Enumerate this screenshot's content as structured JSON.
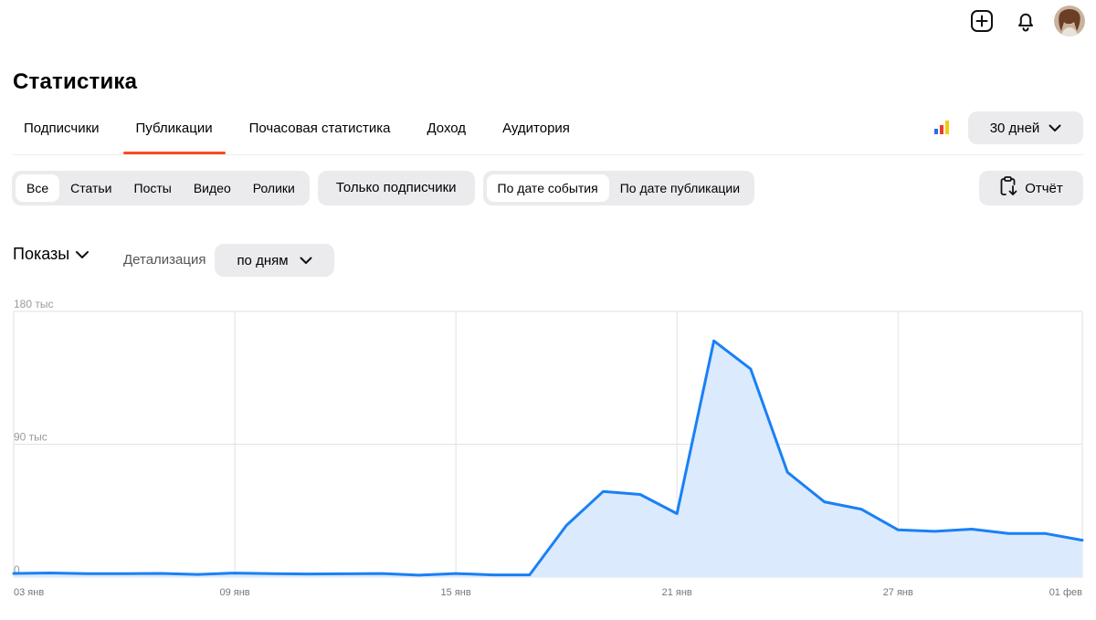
{
  "header": {
    "title": "Статистика",
    "icons": [
      "plus-square-icon",
      "bell-icon",
      "avatar"
    ]
  },
  "tabs": [
    {
      "label": "Подписчики",
      "active": false
    },
    {
      "label": "Публикации",
      "active": true
    },
    {
      "label": "Почасовая статистика",
      "active": false
    },
    {
      "label": "Доход",
      "active": false
    },
    {
      "label": "Аудитория",
      "active": false
    }
  ],
  "period": {
    "label": "30 дней"
  },
  "filters": {
    "types": [
      {
        "label": "Все",
        "active": true
      },
      {
        "label": "Статьи",
        "active": false
      },
      {
        "label": "Посты",
        "active": false
      },
      {
        "label": "Видео",
        "active": false
      },
      {
        "label": "Ролики",
        "active": false
      }
    ],
    "subscribers_only": "Только подписчики",
    "date_mode": [
      {
        "label": "По дате события",
        "active": true
      },
      {
        "label": "По дате публикации",
        "active": false
      }
    ],
    "report": "Отчёт"
  },
  "metric": {
    "label": "Показы"
  },
  "detail": {
    "label": "Детализация",
    "value": "по дням"
  },
  "colors": {
    "accent": "#fa4a1e",
    "line": "#1a80f5",
    "area": "#dbeafd",
    "control_bg": "#ebebee"
  },
  "chart_data": {
    "type": "area",
    "x": [
      "03 янв",
      "04 янв",
      "05 янв",
      "06 янв",
      "07 янв",
      "08 янв",
      "09 янв",
      "10 янв",
      "11 янв",
      "12 янв",
      "13 янв",
      "14 янв",
      "15 янв",
      "16 янв",
      "17 янв",
      "18 янв",
      "19 янв",
      "20 янв",
      "21 янв",
      "22 янв",
      "23 янв",
      "24 янв",
      "25 янв",
      "26 янв",
      "27 янв",
      "28 янв",
      "29 янв",
      "30 янв",
      "31 янв",
      "01 фев"
    ],
    "series": [
      {
        "values": [
          2500,
          2800,
          2300,
          2300,
          2500,
          1800,
          2700,
          2300,
          2100,
          2200,
          2400,
          1300,
          2400,
          1500,
          1500,
          35000,
          58000,
          56000,
          43000,
          160000,
          141000,
          71000,
          51000,
          46000,
          32000,
          31000,
          32500,
          29500,
          29500,
          25000
        ]
      }
    ],
    "ylim": [
      0,
      180000
    ],
    "yticks": [
      {
        "value": 180000,
        "label": "180 тыс"
      },
      {
        "value": 90000,
        "label": "90 тыс"
      },
      {
        "value": 0,
        "label": "0"
      }
    ],
    "xticks": [
      {
        "index": 0,
        "label": "03 янв"
      },
      {
        "index": 6,
        "label": "09 янв"
      },
      {
        "index": 12,
        "label": "15 янв"
      },
      {
        "index": 18,
        "label": "21 янв"
      },
      {
        "index": 24,
        "label": "27 янв"
      },
      {
        "index": 29,
        "label": "01 фев"
      }
    ],
    "grid": true
  }
}
